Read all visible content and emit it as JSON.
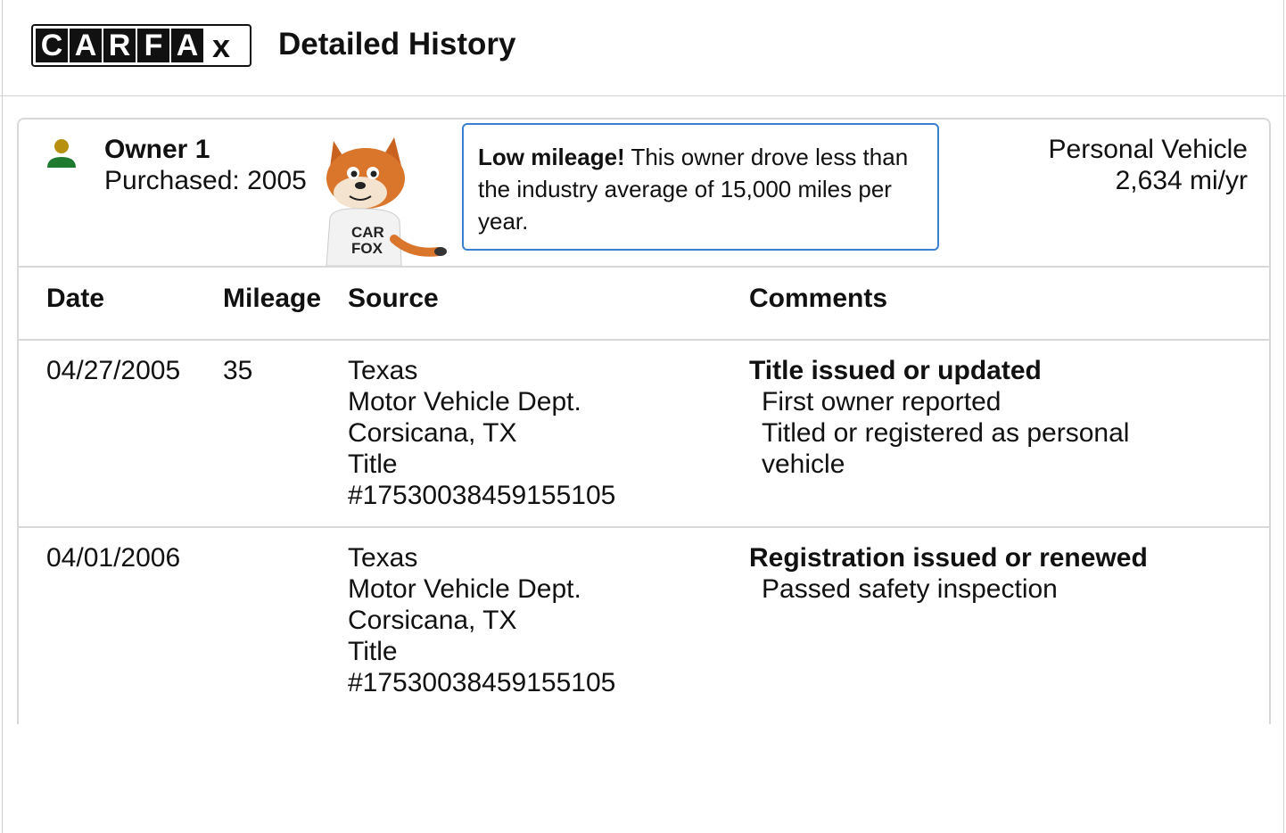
{
  "header": {
    "logo_letters": [
      "C",
      "A",
      "R",
      "F",
      "A",
      "x"
    ],
    "logo_text": "CARFAX",
    "title": "Detailed History"
  },
  "owner": {
    "name": "Owner 1",
    "purchased": "Purchased: 2005",
    "icon": "person-icon",
    "icon_colors": {
      "head": "#b8900f",
      "body": "#1e7a2e"
    }
  },
  "callout": {
    "bold": "Low mileage!",
    "text": " This owner drove less than the industry average of 15,000 miles per year.",
    "border_color": "#3a7fd0"
  },
  "usage": {
    "type": "Personal Vehicle",
    "rate": "2,634 mi/yr"
  },
  "table": {
    "headers": {
      "date": "Date",
      "mileage": "Mileage",
      "source": "Source",
      "comments": "Comments"
    },
    "rows": [
      {
        "date": "04/27/2005",
        "mileage": "35",
        "source": [
          "Texas",
          "Motor Vehicle Dept.",
          "Corsicana, TX",
          "Title",
          "#17530038459155105"
        ],
        "comment_title": "Title issued or updated",
        "comment_lines": [
          "First owner reported",
          "Titled or registered as personal vehicle"
        ]
      },
      {
        "date": "04/01/2006",
        "mileage": "",
        "source": [
          "Texas",
          "Motor Vehicle Dept.",
          "Corsicana, TX",
          "Title",
          "#17530038459155105"
        ],
        "comment_title": "Registration issued or renewed",
        "comment_lines": [
          "Passed safety inspection"
        ]
      }
    ]
  }
}
